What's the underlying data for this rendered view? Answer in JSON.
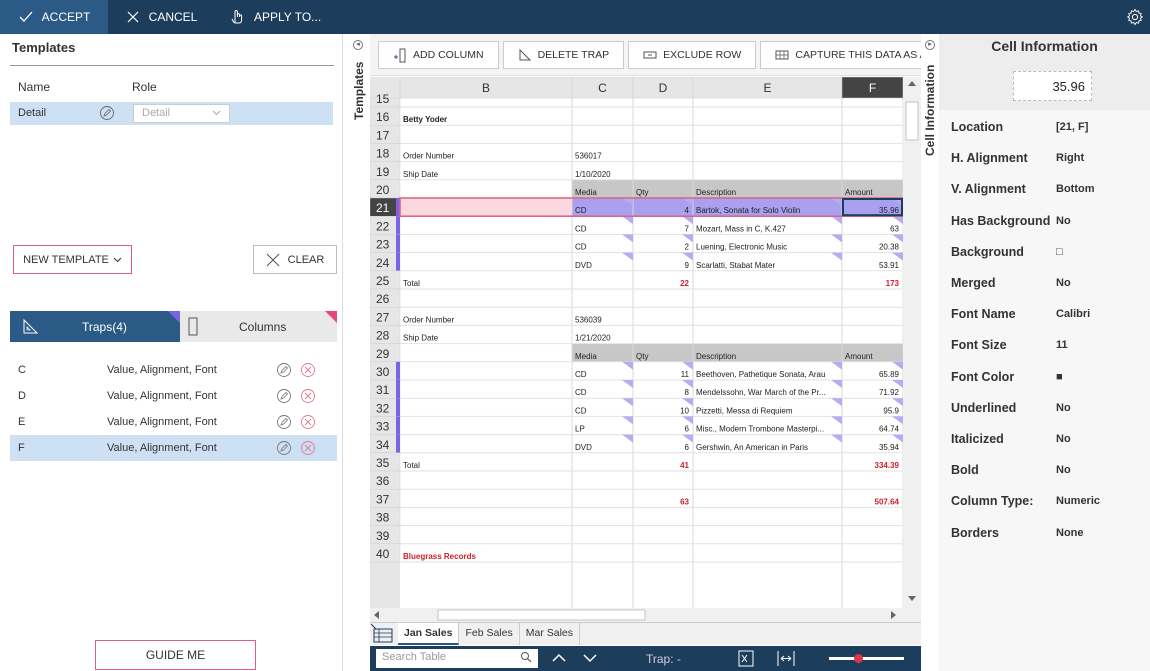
{
  "toolbar": {
    "accept": "ACCEPT",
    "cancel": "CANCEL",
    "apply": "APPLY TO..."
  },
  "templates": {
    "title": "Templates",
    "col_name": "Name",
    "col_role": "Role",
    "rows": [
      {
        "name": "Detail",
        "role": "Detail"
      }
    ],
    "new_template": "NEW TEMPLATE",
    "clear": "CLEAR"
  },
  "traps": {
    "tab_traps": "Traps(4)",
    "tab_columns": "Columns",
    "rows": [
      {
        "col": "C",
        "desc": "Value, Alignment, Font"
      },
      {
        "col": "D",
        "desc": "Value, Alignment, Font"
      },
      {
        "col": "E",
        "desc": "Value, Alignment, Font"
      },
      {
        "col": "F",
        "desc": "Value, Alignment, Font"
      }
    ],
    "guide_me": "GUIDE ME"
  },
  "side_labels": {
    "templates": "Templates",
    "cell_info": "Cell Information"
  },
  "grid_toolbar": {
    "add_column": "ADD COLUMN",
    "delete_trap": "DELETE TRAP",
    "exclude_row": "EXCLUDE ROW",
    "capture": "CAPTURE THIS DATA AS AN AP"
  },
  "grid": {
    "columns": [
      "B",
      "C",
      "D",
      "E",
      "F"
    ],
    "row_numbers": [
      "15",
      "16",
      "17",
      "18",
      "19",
      "20",
      "21",
      "22",
      "23",
      "24",
      "25",
      "26",
      "27",
      "28",
      "29",
      "30",
      "31",
      "32",
      "33",
      "34",
      "35",
      "36",
      "37",
      "38",
      "39",
      "40"
    ],
    "cells": {
      "16": {
        "B": "Betty Yoder"
      },
      "18": {
        "B": "Order Number",
        "C": "536017"
      },
      "19": {
        "B": "Ship Date",
        "C": "1/10/2020"
      },
      "20": {
        "C": "Media",
        "D": "Qty",
        "E": "Description",
        "F": "Amount"
      },
      "21": {
        "C": "CD",
        "D": "4",
        "E": "Bartok, Sonata for Solo Violin",
        "F": "35.96"
      },
      "22": {
        "C": "CD",
        "D": "7",
        "E": "Mozart, Mass in C, K.427",
        "F": "63"
      },
      "23": {
        "C": "CD",
        "D": "2",
        "E": "Luening, Electronic Music",
        "F": "20.38"
      },
      "24": {
        "C": "DVD",
        "D": "9",
        "E": "Scarlatti, Stabat Mater",
        "F": "53.91"
      },
      "25": {
        "B": "Total",
        "D": "22",
        "F": "173"
      },
      "27": {
        "B": "Order Number",
        "C": "536039"
      },
      "28": {
        "B": "Ship Date",
        "C": "1/21/2020"
      },
      "29": {
        "C": "Media",
        "D": "Qty",
        "E": "Description",
        "F": "Amount"
      },
      "30": {
        "C": "CD",
        "D": "11",
        "E": "Beethoven, Pathetique Sonata, Arau",
        "F": "65.89"
      },
      "31": {
        "C": "CD",
        "D": "8",
        "E": "Mendelssohn, War March of the Pr...",
        "F": "71.92"
      },
      "32": {
        "C": "CD",
        "D": "10",
        "E": "Pizzetti, Messa di Requiem",
        "F": "95.9"
      },
      "33": {
        "C": "LP",
        "D": "6",
        "E": "Misc., Modern Trombone Masterpi...",
        "F": "64.74"
      },
      "34": {
        "C": "DVD",
        "D": "6",
        "E": "Gershwin, An American in Paris",
        "F": "35.94"
      },
      "35": {
        "B": "Total",
        "D": "41",
        "F": "334.39"
      },
      "37": {
        "D": "63",
        "F": "507.64"
      },
      "40": {
        "B": "Bluegrass Records"
      }
    },
    "selected_row": "21",
    "selected_col": "F"
  },
  "sheets": [
    "Jan Sales",
    "Feb Sales",
    "Mar Sales"
  ],
  "bottom": {
    "search_placeholder": "Search Table",
    "trap_label": "Trap: -"
  },
  "cell_info": {
    "title": "Cell Information",
    "value": "35.96",
    "props": [
      {
        "label": "Location",
        "value": "[21, F]"
      },
      {
        "label": "H. Alignment",
        "value": "Right"
      },
      {
        "label": "V. Alignment",
        "value": "Bottom"
      },
      {
        "label": "Has Background",
        "value": "No"
      },
      {
        "label": "Background",
        "value": "□"
      },
      {
        "label": "Merged",
        "value": "No"
      },
      {
        "label": "Font Name",
        "value": "Calibri"
      },
      {
        "label": "Font Size",
        "value": "11"
      },
      {
        "label": "Font Color",
        "value": "■"
      },
      {
        "label": "Underlined",
        "value": "No"
      },
      {
        "label": "Italicized",
        "value": "No"
      },
      {
        "label": "Bold",
        "value": "No"
      },
      {
        "label": "Column Type:",
        "value": "Numeric"
      },
      {
        "label": "Borders",
        "value": "None"
      }
    ]
  },
  "colors": {
    "navy": "#1d3d5c",
    "accent": "#2b5a86",
    "select_blue": "#cde0f4",
    "trap_purple": "#7b63e8",
    "pink": "#e06080",
    "total_red": "#d0202a"
  }
}
